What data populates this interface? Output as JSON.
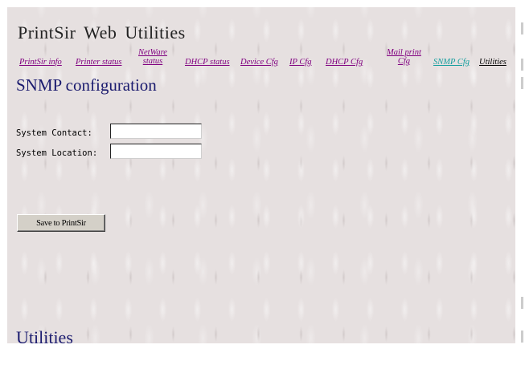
{
  "app": {
    "title": "PrintSir Web Utilities"
  },
  "nav": {
    "items": [
      {
        "label": "PrintSir info"
      },
      {
        "label": "Printer status"
      },
      {
        "label": "NetWare",
        "label2": "status"
      },
      {
        "label": "DHCP status"
      },
      {
        "label": "Device Cfg"
      },
      {
        "label": "IP Cfg"
      },
      {
        "label": "DHCP Cfg"
      },
      {
        "label": "Mail print",
        "label2": "Cfg"
      },
      {
        "label": "SNMP Cfg",
        "current": true
      },
      {
        "label": "Utilities"
      }
    ]
  },
  "page": {
    "title": "SNMP configuration"
  },
  "form": {
    "contact_label": "System Contact:",
    "contact_value": "",
    "location_label": "System Location:",
    "location_value": ""
  },
  "actions": {
    "save_label": "Save to PrintSir"
  },
  "section": {
    "utilities_heading": "Utilities"
  },
  "colors": {
    "heading": "#1a1a6e",
    "link_visited": "#800080",
    "link_current": "#139e9e",
    "background": "#e6e0e0"
  }
}
